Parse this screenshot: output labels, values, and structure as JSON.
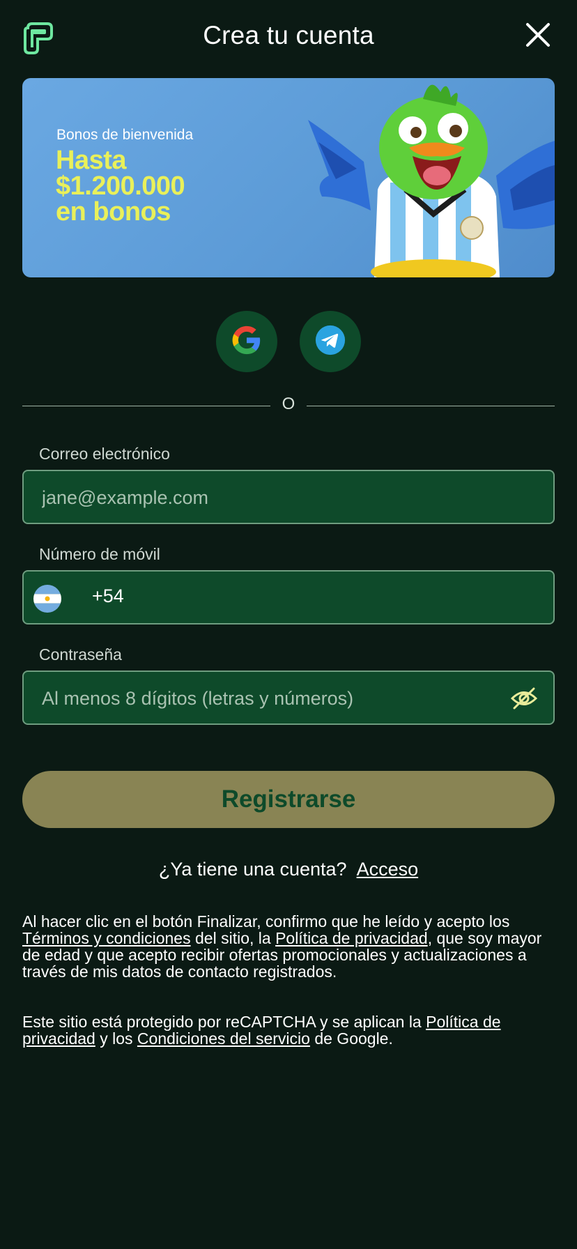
{
  "header": {
    "title": "Crea tu cuenta",
    "logo_icon": "brand-logo-icon",
    "close_icon": "close-icon"
  },
  "banner": {
    "subtitle": "Bonos de bienvenida",
    "headline_line1": "Hasta",
    "headline_line2": "$1.200.000",
    "headline_line3": "en bonos",
    "mascot_icon": "parrot-mascot-illustration"
  },
  "social": {
    "google_icon": "google-icon",
    "telegram_icon": "telegram-icon"
  },
  "divider": {
    "text": "O"
  },
  "form": {
    "email_label": "Correo electrónico",
    "email_placeholder": "jane@example.com",
    "email_value": "",
    "phone_label": "Número de móvil",
    "phone_country_code": "+54",
    "phone_flag_icon": "argentina-flag-icon",
    "phone_value": "",
    "password_label": "Contraseña",
    "password_placeholder": "Al menos 8 dígitos (letras y números)",
    "password_value": "",
    "password_toggle_icon": "eye-off-icon",
    "submit_label": "Registrarse"
  },
  "login": {
    "prompt": "¿Ya tiene una cuenta?",
    "link": "Acceso"
  },
  "legal": {
    "p1_part1": "Al hacer clic en el botón Finalizar, confirmo que he leído y acepto los ",
    "p1_link1": "Términos y condiciones",
    "p1_part2": " del sitio, la ",
    "p1_link2": "Política de privacidad",
    "p1_part3": ", que soy mayor de edad y que acepto recibir ofertas promocionales y actualizaciones a través de mis datos de contacto registrados.",
    "p2_part1": "Este sitio está protegido por reCAPTCHA y se aplican la ",
    "p2_link1": "Política de privacidad",
    "p2_part2": " y los ",
    "p2_link2": "Condiciones del servicio",
    "p2_part3": " de Google."
  },
  "colors": {
    "background": "#0b1a14",
    "field_bg": "#0e4a2a",
    "field_border": "#6f9d80",
    "button_bg": "#898454",
    "button_text": "#0e4a2a",
    "banner_bg": "#5b9ad6",
    "banner_headline": "#e9f05a"
  }
}
